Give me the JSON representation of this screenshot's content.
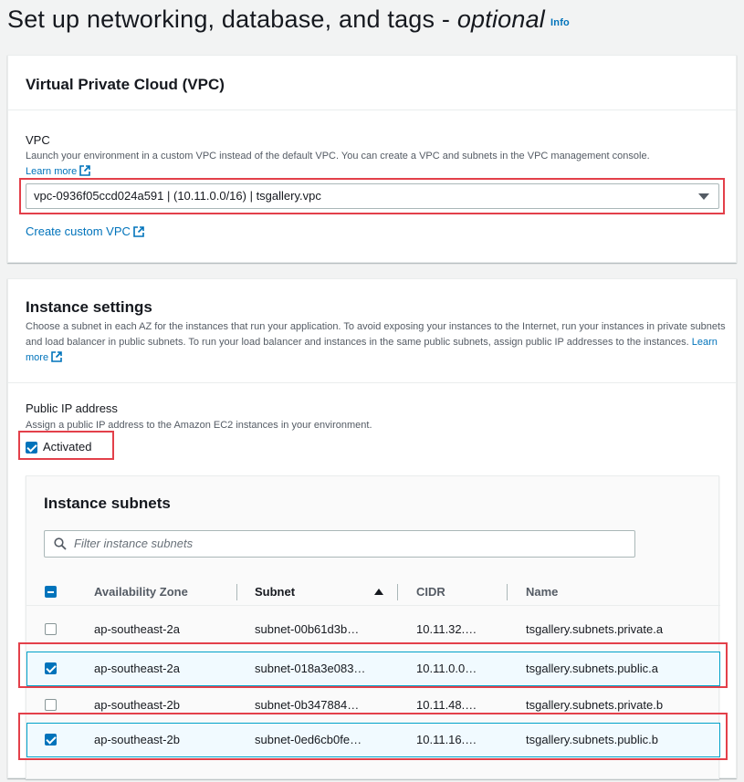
{
  "page": {
    "title_main": "Set up networking, database, and tags - ",
    "title_optional": "optional",
    "info": "Info"
  },
  "vpc_panel": {
    "title": "Virtual Private Cloud (VPC)",
    "label": "VPC",
    "description": "Launch your environment in a custom VPC instead of the default VPC. You can create a VPC and subnets in the VPC management console.",
    "learn_more": "Learn more",
    "selected_vpc": "vpc-0936f05ccd024a591 | (10.11.0.0/16) | tsgallery.vpc",
    "create_link": "Create custom VPC"
  },
  "instance_panel": {
    "title": "Instance settings",
    "description": "Choose a subnet in each AZ for the instances that run your application. To avoid exposing your instances to the Internet, run your instances in private subnets and load balancer in public subnets. To run your load balancer and instances in the same public subnets, assign public IP addresses to the instances.",
    "learn_more": "Learn more",
    "public_ip_label": "Public IP address",
    "public_ip_desc": "Assign a public IP address to the Amazon EC2 instances in your environment.",
    "activated_label": "Activated",
    "activated": true
  },
  "subnets": {
    "title": "Instance subnets",
    "filter_placeholder": "Filter instance subnets",
    "columns": [
      "Availability Zone",
      "Subnet",
      "CIDR",
      "Name"
    ],
    "sorted_column": "Subnet",
    "rows": [
      {
        "az": "ap-southeast-2a",
        "subnet": "subnet-00b61d3b…",
        "cidr": "10.11.32.…",
        "name": "tsgallery.subnets.private.a",
        "checked": false
      },
      {
        "az": "ap-southeast-2a",
        "subnet": "subnet-018a3e083…",
        "cidr": "10.11.0.0…",
        "name": "tsgallery.subnets.public.a",
        "checked": true
      },
      {
        "az": "ap-southeast-2b",
        "subnet": "subnet-0b347884…",
        "cidr": "10.11.48.…",
        "name": "tsgallery.subnets.private.b",
        "checked": false
      },
      {
        "az": "ap-southeast-2b",
        "subnet": "subnet-0ed6cb0fe…",
        "cidr": "10.11.16.…",
        "name": "tsgallery.subnets.public.b",
        "checked": true
      }
    ]
  },
  "colors": {
    "accent": "#0073bb",
    "highlight": "#e3404a",
    "selected_row": "#f1faff"
  }
}
